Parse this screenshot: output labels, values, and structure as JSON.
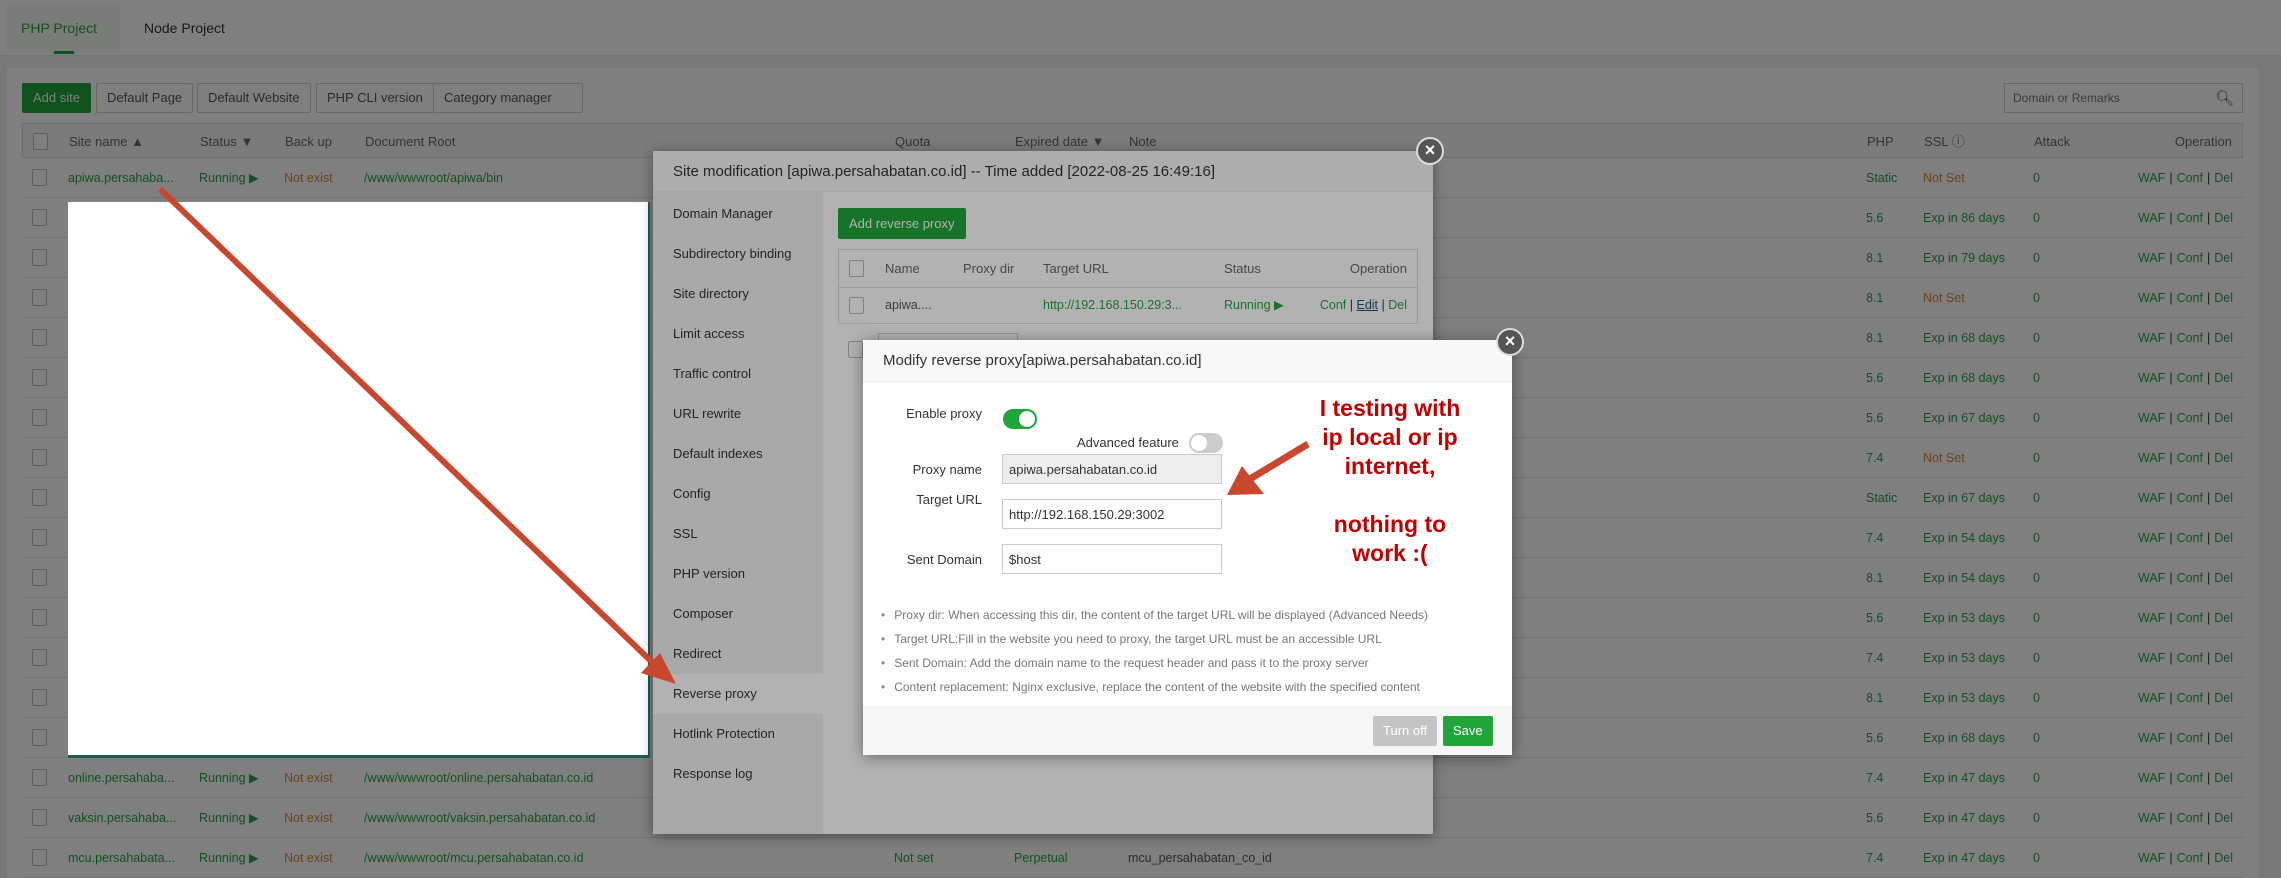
{
  "tabs": [
    {
      "label": "PHP Project",
      "active": true
    },
    {
      "label": "Node Project",
      "active": false
    }
  ],
  "toolbar": {
    "add_site": "Add site",
    "default_page": "Default Page",
    "default_website": "Default Website",
    "php_cli": "PHP CLI version",
    "category": "Category manager"
  },
  "search": {
    "placeholder": "Domain or Remarks",
    "icon": "search-icon"
  },
  "table": {
    "headers": {
      "site_name": "Site name ▲",
      "status": "Status ▼",
      "backup": "Back up",
      "doc_root": "Document Root",
      "quota": "Quota",
      "expired": "Expired date ▼",
      "note": "Note",
      "php": "PHP",
      "ssl": "SSL ⓘ",
      "attack": "Attack",
      "operation": "Operation"
    },
    "rows": [
      {
        "name": "apiwa.persahaba...",
        "status": "Running ▶",
        "backup": "Not exist",
        "root": "/www/wwwroot/apiwa/bin",
        "php": "Static",
        "ssl": "Not Set",
        "attack": "0"
      },
      {
        "php": "5.6",
        "ssl": "Exp in 86 days",
        "attack": "0"
      },
      {
        "php": "8.1",
        "ssl": "Exp in 79 days",
        "attack": "0"
      },
      {
        "php": "8.1",
        "ssl": "Not Set",
        "attack": "0"
      },
      {
        "php": "8.1",
        "ssl": "Exp in 68 days",
        "attack": "0"
      },
      {
        "php": "5.6",
        "ssl": "Exp in 68 days",
        "attack": "0"
      },
      {
        "php": "5.6",
        "ssl": "Exp in 67 days",
        "attack": "0"
      },
      {
        "php": "7.4",
        "ssl": "Not Set",
        "attack": "0"
      },
      {
        "php": "Static",
        "ssl": "Exp in 67 days",
        "attack": "0"
      },
      {
        "php": "7.4",
        "ssl": "Exp in 54 days",
        "attack": "0"
      },
      {
        "php": "8.1",
        "ssl": "Exp in 54 days",
        "attack": "0"
      },
      {
        "php": "5.6",
        "ssl": "Exp in 53 days",
        "attack": "0"
      },
      {
        "php": "7.4",
        "ssl": "Exp in 53 days",
        "attack": "0"
      },
      {
        "php": "8.1",
        "ssl": "Exp in 53 days",
        "attack": "0"
      },
      {
        "php": "5.6",
        "ssl": "Exp in 68 days",
        "attack": "0"
      },
      {
        "name": "online.persahaba...",
        "status": "Running ▶",
        "backup": "Not exist",
        "root": "/www/wwwroot/online.persahabatan.co.id",
        "php": "7.4",
        "ssl": "Exp in 47 days",
        "attack": "0"
      },
      {
        "name": "vaksin.persahaba...",
        "status": "Running ▶",
        "backup": "Not exist",
        "root": "/www/wwwroot/vaksin.persahabatan.co.id",
        "php": "5.6",
        "ssl": "Exp in 47 days",
        "attack": "0"
      },
      {
        "name": "mcu.persahabata...",
        "status": "Running ▶",
        "backup": "Not exist",
        "root": "/www/wwwroot/mcu.persahabatan.co.id",
        "quota": "Not set",
        "expired": "Perpetual",
        "note": "mcu_persahabatan_co_id",
        "php": "7.4",
        "ssl": "Exp in 47 days",
        "attack": "0"
      }
    ],
    "ops": {
      "waf": "WAF",
      "conf": "Conf",
      "del": "Del",
      "sep": "|"
    }
  },
  "site_modal": {
    "title": "Site modification [apiwa.persahabatan.co.id] -- Time added [2022-08-25 16:49:16]",
    "menu": [
      "Domain Manager",
      "Subdirectory binding",
      "Site directory",
      "Limit access",
      "Traffic control",
      "URL rewrite",
      "Default indexes",
      "Config",
      "SSL",
      "PHP version",
      "Composer",
      "Redirect",
      "Reverse proxy",
      "Hotlink Protection",
      "Response log"
    ],
    "active_menu": "Reverse proxy",
    "add_button": "Add reverse proxy",
    "proxy_table": {
      "headers": {
        "name": "Name",
        "dir": "Proxy dir",
        "url": "Target URL",
        "status": "Status",
        "op": "Operation"
      },
      "row": {
        "name": "apiwa....",
        "url": "http://192.168.150.29:3...",
        "status": "Running ▶",
        "conf": "Conf",
        "edit": "Edit",
        "del": "Del"
      }
    }
  },
  "proxy_dialog": {
    "title": "Modify reverse proxy[apiwa.persahabatan.co.id]",
    "enable_label": "Enable proxy",
    "enable_on": true,
    "advanced_label": "Advanced feature",
    "advanced_on": false,
    "name_label": "Proxy name",
    "name_value": "apiwa.persahabatan.co.id",
    "url_label": "Target URL",
    "url_value": "http://192.168.150.29:3002",
    "domain_label": "Sent Domain",
    "domain_value": "$host",
    "notes": [
      "Proxy dir: When accessing this dir, the content of the target URL will be displayed (Advanced Needs)",
      "Target URL:Fill in the website you need to proxy, the target URL must be an accessible URL",
      "Sent Domain: Add the domain name to the request header and pass it to the proxy server",
      "Content replacement: Nginx exclusive, replace the content of the website with the specified content"
    ],
    "turn_off": "Turn off",
    "save": "Save"
  },
  "annotation": "I testing with\nip local or ip\ninternet,\n\nnothing to\nwork :(",
  "colors": {
    "green": "#20a53a",
    "orange": "#d9822b",
    "annotation": "#c00000",
    "arrow": "#c8472f"
  }
}
